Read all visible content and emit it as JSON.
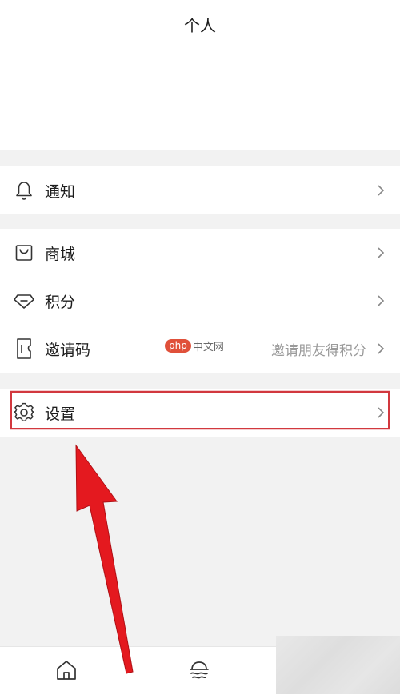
{
  "header": {
    "title": "个人"
  },
  "notifications": {
    "label": "通知",
    "icon": "bell-icon"
  },
  "menu": {
    "mall": {
      "label": "商城",
      "icon": "shopping-bag-icon"
    },
    "points": {
      "label": "积分",
      "icon": "diamond-icon"
    },
    "invite": {
      "label": "邀请码",
      "hint": "邀请朋友得积分",
      "icon": "ticket-icon"
    }
  },
  "settings": {
    "label": "设置",
    "icon": "gear-icon"
  },
  "watermark": {
    "badge": "php",
    "text": "中文网"
  },
  "tabbar": {
    "items": [
      {
        "icon": "home-icon"
      },
      {
        "icon": "discover-icon"
      }
    ]
  },
  "colors": {
    "page_background": "#f2f2f2",
    "highlight_border": "#d2383e",
    "arrow_red": "#e4191f"
  }
}
